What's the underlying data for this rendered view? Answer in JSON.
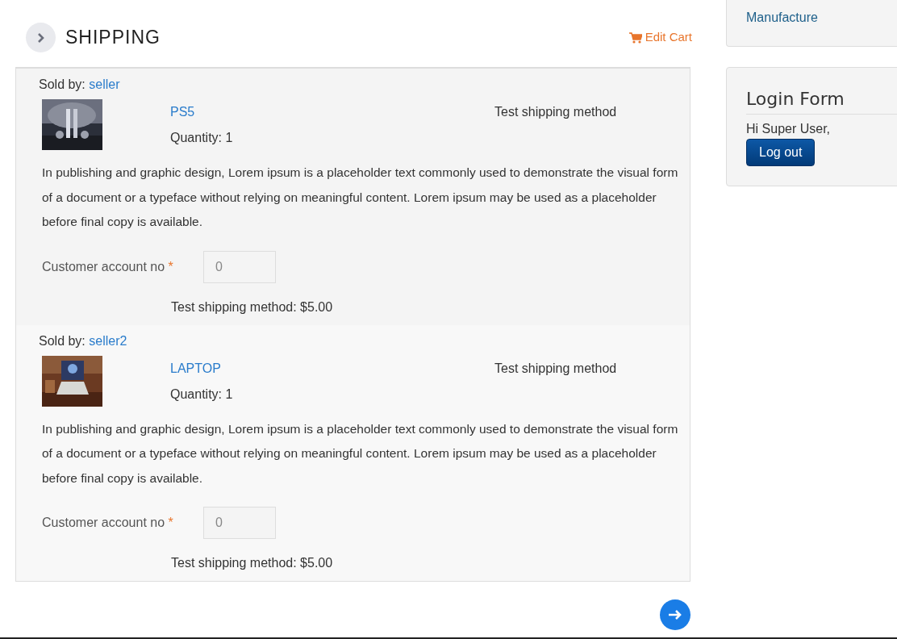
{
  "header": {
    "title": "SHIPPING",
    "edit_cart": "Edit Cart"
  },
  "vendors": [
    {
      "sold_by_label": "Sold by:",
      "seller": "seller",
      "product": "PS5",
      "quantity": "Quantity: 1",
      "shipping_method": "Test shipping method",
      "description": "In publishing and graphic design, Lorem ipsum is a placeholder text commonly used to demonstrate the visual form of a document or a typeface without relying on meaningful content. Lorem ipsum may be used as a placeholder before final copy is available.",
      "field_label": "Customer account no",
      "required_mark": "*",
      "field_value": "0",
      "shipping_total": "Test shipping method: $5.00"
    },
    {
      "sold_by_label": "Sold by:",
      "seller": "seller2",
      "product": "LAPTOP",
      "quantity": "Quantity: 1",
      "shipping_method": "Test shipping method",
      "description": "In publishing and graphic design, Lorem ipsum is a placeholder text commonly used to demonstrate the visual form of a document or a typeface without relying on meaningful content. Lorem ipsum may be used as a placeholder before final copy is available.",
      "field_label": "Customer account no",
      "required_mark": "*",
      "field_value": "0",
      "shipping_total": "Test shipping method: $5.00"
    }
  ],
  "sidebar": {
    "menu_link": "Manufacture",
    "login": {
      "title": "Login Form",
      "greeting": "Hi Super User,",
      "logout": "Log out"
    }
  }
}
